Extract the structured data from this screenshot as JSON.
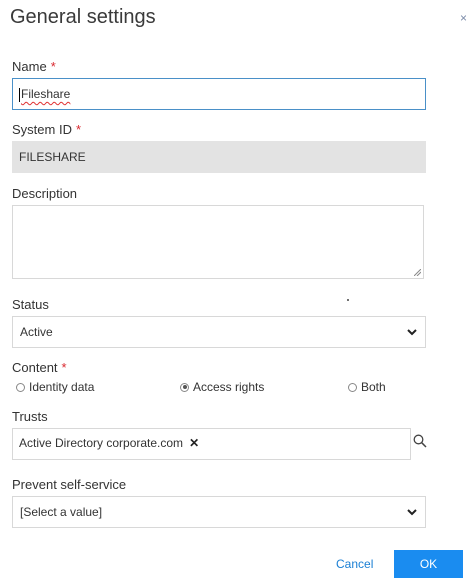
{
  "dialog": {
    "title": "General settings",
    "close_label": "×"
  },
  "fields": {
    "name": {
      "label": "Name",
      "required_mark": "*",
      "value": "Fileshare"
    },
    "system_id": {
      "label": "System ID",
      "required_mark": "*",
      "value": "FILESHARE"
    },
    "description": {
      "label": "Description",
      "value": ""
    },
    "status": {
      "label": "Status",
      "selected": "Active"
    },
    "content": {
      "label": "Content",
      "required_mark": "*",
      "options": [
        {
          "label": "Identity data",
          "checked": false
        },
        {
          "label": "Access rights",
          "checked": true
        },
        {
          "label": "Both",
          "checked": false
        }
      ]
    },
    "trusts": {
      "label": "Trusts",
      "tags": [
        {
          "label": "Active Directory corporate.com",
          "remove": "✕"
        }
      ]
    },
    "prevent_self_service": {
      "label": "Prevent self-service",
      "selected": "[Select a value]"
    }
  },
  "footer": {
    "cancel_label": "Cancel",
    "ok_label": "OK"
  },
  "icons": {
    "close": "close-icon",
    "search": "search-icon",
    "chevron": "chevron-down-icon",
    "resize": "resize-handle-icon"
  },
  "colors": {
    "accent": "#1a8cf0",
    "required": "#d9272e",
    "link": "#1a7fd4",
    "readonly_bg": "#e3e3e3"
  }
}
